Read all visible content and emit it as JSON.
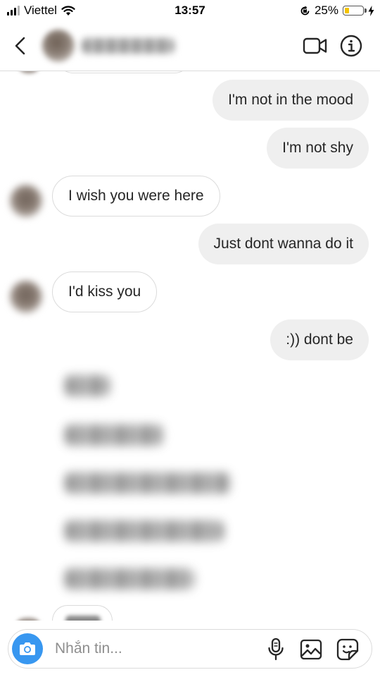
{
  "status_bar": {
    "carrier": "Viettel",
    "time": "13:57",
    "battery_percent": "25%",
    "battery_level": 0.25,
    "battery_color": "#f5c300",
    "icons": [
      "signal-icon",
      "wifi-icon",
      "orientation-lock-icon",
      "battery-icon",
      "charging-bolt-icon"
    ]
  },
  "header": {
    "back_icon": "chevron-left-icon",
    "contact_name": "",
    "video_call_icon": "video-camera-icon",
    "info_icon": "info-icon"
  },
  "messages": [
    {
      "direction": "sent",
      "text": "I'm not in the mood"
    },
    {
      "direction": "sent",
      "text": "I'm not shy"
    },
    {
      "direction": "received",
      "text": "I wish you were here"
    },
    {
      "direction": "sent",
      "text": "Just dont wanna do it"
    },
    {
      "direction": "received",
      "text": "I'd kiss you"
    },
    {
      "direction": "sent",
      "text": ":)) dont be"
    }
  ],
  "composer": {
    "placeholder": "Nhắn tin...",
    "value": "",
    "camera_icon": "camera-icon",
    "mic_icon": "microphone-icon",
    "gallery_icon": "image-icon",
    "sticker_icon": "sticker-icon",
    "accent_color": "#3897f0"
  },
  "colors": {
    "sent_bubble": "#efefef",
    "received_border": "#dbdbdb",
    "text": "#262626"
  }
}
